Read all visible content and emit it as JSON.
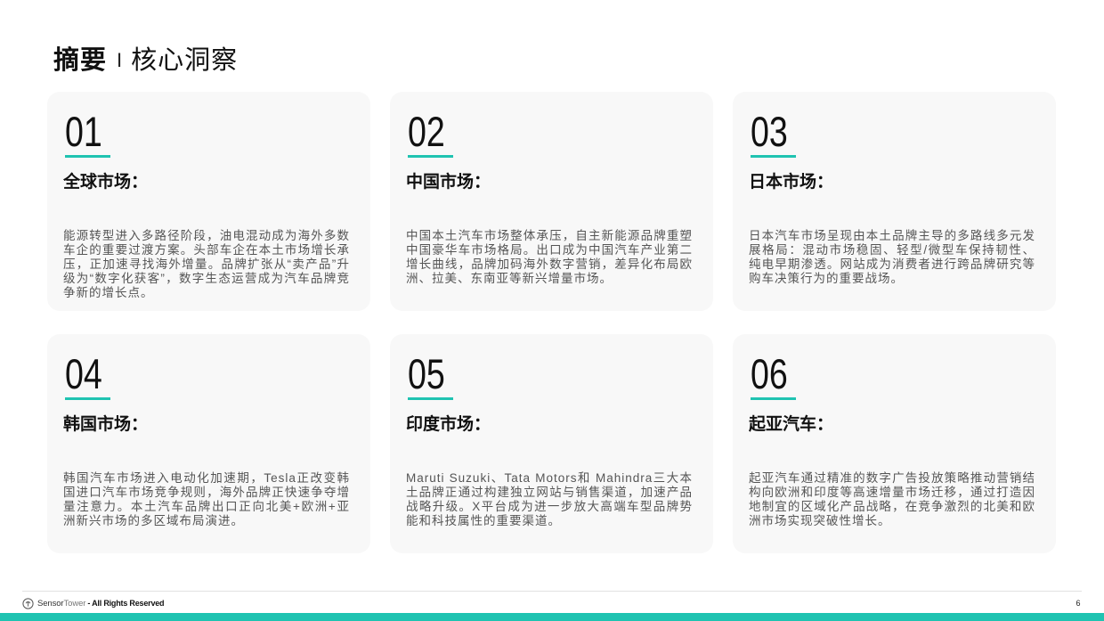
{
  "colors": {
    "accent": "#1fc3b1",
    "card_bg": "#f8f8f8",
    "body_text": "#555555",
    "heading_text": "#111111"
  },
  "title": {
    "main": "摘要",
    "separator": "I",
    "sub": "核心洞察"
  },
  "cards": [
    {
      "number": "01",
      "heading": "全球市场：",
      "body": "能源转型进入多路径阶段，油电混动成为海外多数车企的重要过渡方案。头部车企在本土市场增长承压，正加速寻找海外增量。品牌扩张从“卖产品”升级为“数字化获客”，数字生态运营成为汽车品牌竞争新的增长点。"
    },
    {
      "number": "02",
      "heading": "中国市场：",
      "body": "中国本土汽车市场整体承压，自主新能源品牌重塑中国豪华车市场格局。出口成为中国汽车产业第二增长曲线，品牌加码海外数字营销，差异化布局欧洲、拉美、东南亚等新兴增量市场。"
    },
    {
      "number": "03",
      "heading": "日本市场：",
      "body": "日本汽车市场呈现由本土品牌主导的多路线多元发展格局：混动市场稳固、轻型/微型车保持韧性、纯电早期渗透。网站成为消费者进行跨品牌研究等购车决策行为的重要战场。"
    },
    {
      "number": "04",
      "heading": "韩国市场：",
      "body": "韩国汽车市场进入电动化加速期，Tesla正改变韩国进口汽车市场竞争规则，海外品牌正快速争夺增量注意力。本土汽车品牌出口正向北美+欧洲+亚洲新兴市场的多区域布局演进。"
    },
    {
      "number": "05",
      "heading": "印度市场：",
      "body": "Maruti Suzuki、Tata Motors和 Mahindra三大本土品牌正通过构建独立网站与销售渠道，加速产品战略升级。X平台成为进一步放大高端车型品牌势能和科技属性的重要渠道。"
    },
    {
      "number": "06",
      "heading": "起亚汽车：",
      "body": "起亚汽车通过精准的数字广告投放策略推动营销结构向欧洲和印度等高速增量市场迁移，通过打造因地制宜的区域化产品战略，在竞争激烈的北美和欧洲市场实现突破性增长。"
    }
  ],
  "footer": {
    "logo_icon": "sensor-tower-logo-icon",
    "brand_word_1": "Sensor",
    "brand_word_2": "Tower",
    "rights": "- All Rights Reserved",
    "page_number": "6"
  }
}
